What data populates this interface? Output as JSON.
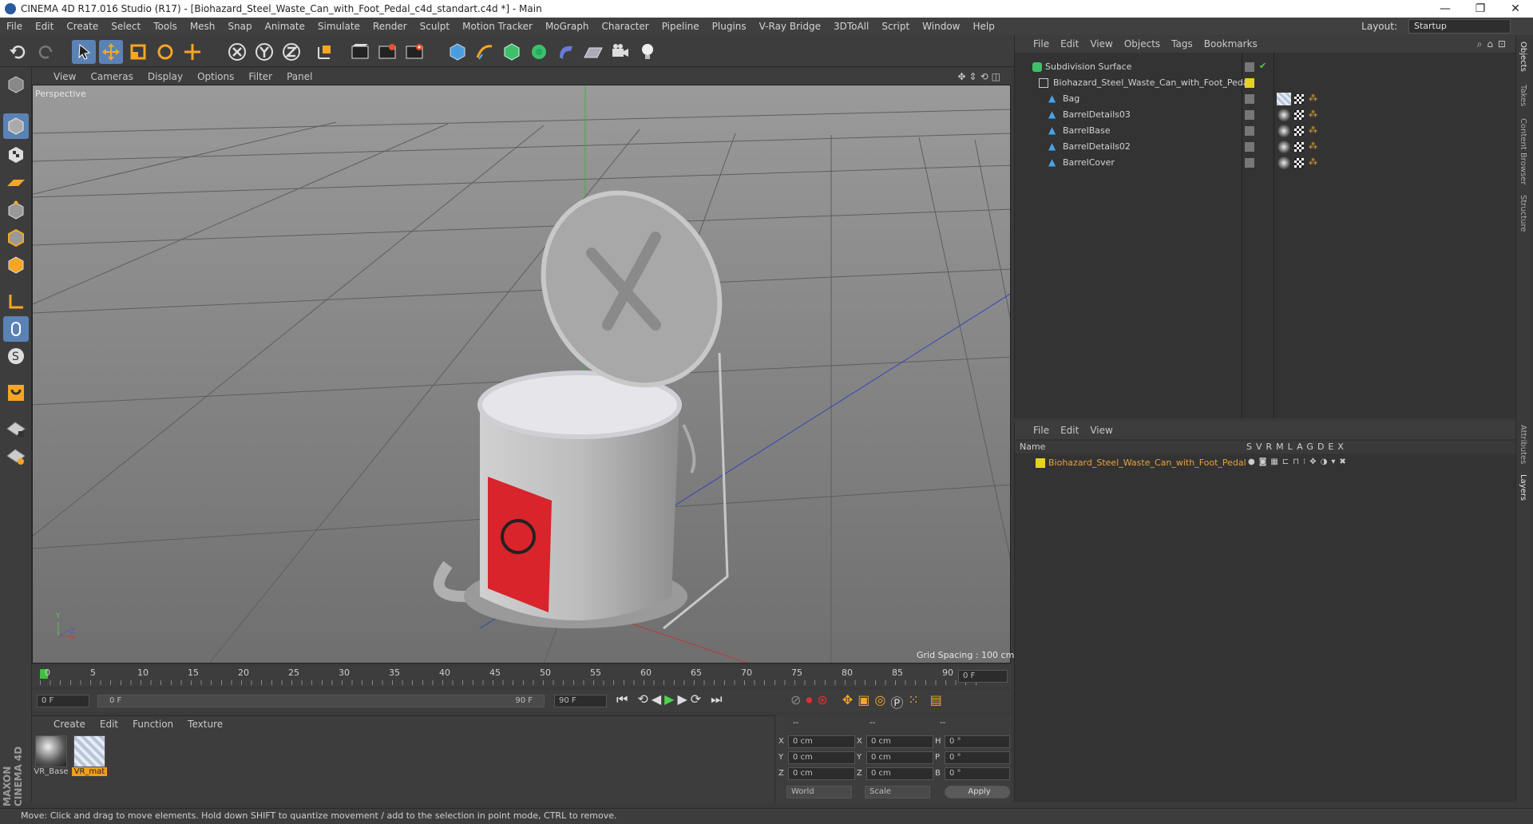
{
  "window": {
    "title": "CINEMA 4D R17.016 Studio (R17) - [Biohazard_Steel_Waste_Can_with_Foot_Pedal_c4d_standart.c4d *] - Main",
    "controls": [
      "—",
      "❐",
      "✕"
    ]
  },
  "menubar": {
    "items": [
      "File",
      "Edit",
      "Create",
      "Select",
      "Tools",
      "Mesh",
      "Snap",
      "Animate",
      "Simulate",
      "Render",
      "Sculpt",
      "Motion Tracker",
      "MoGraph",
      "Character",
      "Pipeline",
      "Plugins",
      "V-Ray Bridge",
      "3DToAll",
      "Script",
      "Window",
      "Help"
    ],
    "layout_label": "Layout:",
    "layout_value": "Startup"
  },
  "viewport": {
    "menu": [
      "View",
      "Cameras",
      "Display",
      "Options",
      "Filter",
      "Panel"
    ],
    "label": "Perspective",
    "grid_spacing": "Grid Spacing : 100 cm",
    "axis_labels": {
      "y": "Y",
      "z": "Z",
      "x": "X"
    }
  },
  "timeline": {
    "ticks": [
      "0",
      "5",
      "10",
      "15",
      "20",
      "25",
      "30",
      "35",
      "40",
      "45",
      "50",
      "55",
      "60",
      "65",
      "70",
      "75",
      "80",
      "85",
      "90"
    ],
    "current_frame": "0 F"
  },
  "transport": {
    "start": "0 F",
    "range_start": "0 F",
    "range_end": "90 F",
    "end": "90 F"
  },
  "materials": {
    "menu": [
      "Create",
      "Edit",
      "Function",
      "Texture"
    ],
    "items": [
      {
        "label": "VR_Base",
        "selected": false
      },
      {
        "label": "VR_mat",
        "selected": true
      }
    ]
  },
  "coordinates": {
    "headers": [
      "--",
      "--",
      "--"
    ],
    "rows": [
      {
        "a": "X",
        "av": "0 cm",
        "b": "X",
        "bv": "0 cm",
        "c": "H",
        "cv": "0 °"
      },
      {
        "a": "Y",
        "av": "0 cm",
        "b": "Y",
        "bv": "0 cm",
        "c": "P",
        "cv": "0 °"
      },
      {
        "a": "Z",
        "av": "0 cm",
        "b": "Z",
        "bv": "0 cm",
        "c": "B",
        "cv": "0 °"
      }
    ],
    "mode1": "World",
    "mode2": "Scale",
    "apply": "Apply"
  },
  "objects": {
    "menu": [
      "File",
      "Edit",
      "View",
      "Objects",
      "Tags",
      "Bookmarks"
    ],
    "rows": [
      {
        "name": "Subdivision Surface",
        "indent": 0
      },
      {
        "name": "Biohazard_Steel_Waste_Can_with_Foot_Pedal",
        "indent": 1
      },
      {
        "name": "Bag",
        "indent": 2
      },
      {
        "name": "BarrelDetails03",
        "indent": 2
      },
      {
        "name": "BarrelBase",
        "indent": 2
      },
      {
        "name": "BarrelDetails02",
        "indent": 2
      },
      {
        "name": "BarrelCover",
        "indent": 2
      }
    ]
  },
  "layers": {
    "menu": [
      "File",
      "Edit",
      "View"
    ],
    "header_name": "Name",
    "columns": [
      "S",
      "V",
      "R",
      "M",
      "L",
      "A",
      "G",
      "D",
      "E",
      "X"
    ],
    "rows": [
      {
        "name": "Biohazard_Steel_Waste_Can_with_Foot_Pedal"
      }
    ]
  },
  "side_tabs": [
    "Objects",
    "Takes",
    "Content Browser",
    "Structure",
    "Attributes",
    "Layers"
  ],
  "status": "Move: Click and drag to move elements. Hold down SHIFT to quantize movement / add to the selection in point mode, CTRL to remove.",
  "brand": "MAXON CINEMA 4D",
  "colors": {
    "accent": "#5b82b5",
    "layer_yellow": "#e6d31e",
    "layer_text": "#e8a33c",
    "selected_mat": "#f0a01a"
  }
}
